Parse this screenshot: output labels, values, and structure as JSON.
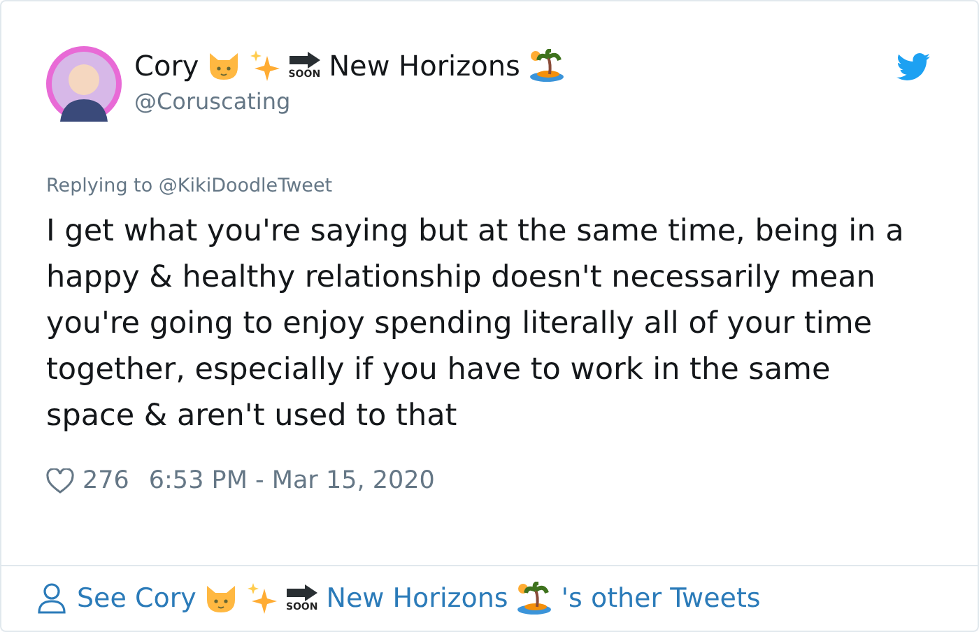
{
  "author": {
    "name_parts": [
      {
        "kind": "text",
        "text": "Cory"
      },
      {
        "kind": "cat"
      },
      {
        "kind": "sparkles"
      },
      {
        "kind": "soon",
        "text": "SOON"
      },
      {
        "kind": "text",
        "text": "New Horizons"
      },
      {
        "kind": "island"
      }
    ],
    "handle": "@Coruscating"
  },
  "reply_to": "Replying to @KikiDoodleTweet",
  "body": "I get what you're saying but at the same time, being in a happy & healthy relationship doesn't necessarily mean you're going to enjoy spending literally all of your time together, especially if you have to work in the same space & aren't used to that",
  "likes": "276",
  "timestamp": "6:53 PM - Mar 15, 2020",
  "footer_link": {
    "parts": [
      {
        "kind": "text",
        "text": "See Cory"
      },
      {
        "kind": "cat"
      },
      {
        "kind": "sparkles"
      },
      {
        "kind": "soon",
        "text": "SOON"
      },
      {
        "kind": "text",
        "text": "New Horizons"
      },
      {
        "kind": "island"
      },
      {
        "kind": "text",
        "text": "'s other Tweets"
      }
    ]
  }
}
